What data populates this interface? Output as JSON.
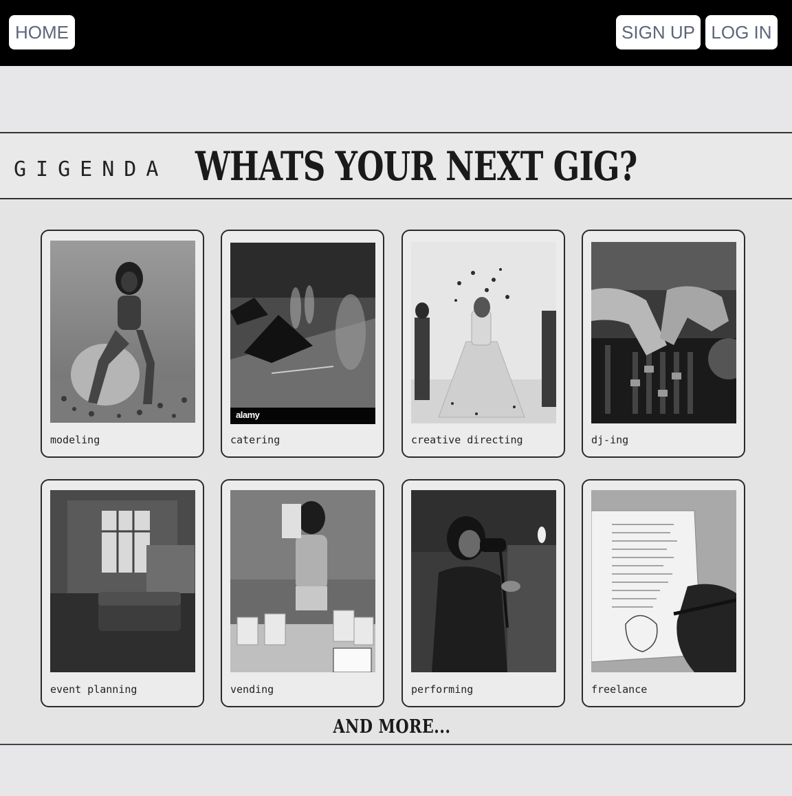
{
  "nav": {
    "home_label": "HOME",
    "signup_label": "SIGN UP",
    "login_label": "LOG IN"
  },
  "header": {
    "brand": "GIGENDA",
    "headline": "WHATS YOUR NEXT GIG?"
  },
  "gigs": [
    {
      "label": "modeling",
      "image": "model-seated-photo"
    },
    {
      "label": "catering",
      "image": "table-setting-photo",
      "watermark": "alamy"
    },
    {
      "label": "creative directing",
      "image": "bride-photoshoot-photo"
    },
    {
      "label": "dj-ing",
      "image": "dj-mixer-photo"
    },
    {
      "label": "event planning",
      "image": "loft-room-photo"
    },
    {
      "label": "vending",
      "image": "vendor-bags-photo"
    },
    {
      "label": "performing",
      "image": "singer-microphone-photo"
    },
    {
      "label": "freelance",
      "image": "handwritten-notebook-photo"
    }
  ],
  "footer": {
    "and_more": "AND MORE..."
  },
  "colors": {
    "topbar": "#000000",
    "page_bg": "#e7e6e8",
    "nav_text": "#5b6679",
    "border": "#2a2a2a"
  }
}
